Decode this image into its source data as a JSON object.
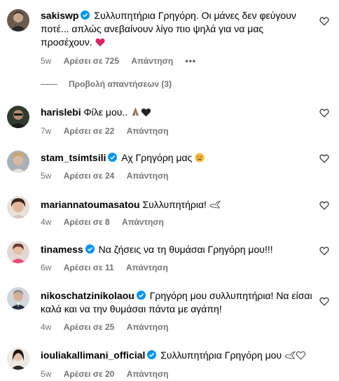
{
  "verified_color": "#0095f6",
  "comments": [
    {
      "username": "sakiswp",
      "verified": true,
      "text": "Συλλυπητήρια Γρηγόρη. Οι μάνες δεν φεύγουν ποτέ... απλώς ανεβαίνουν λίγο πιο ψηλά για να μας προσέχουν.",
      "emoji": "heart-red",
      "time": "5w",
      "likes": "Αρέσει σε 725",
      "reply": "Απάντηση",
      "more": "•••"
    },
    {
      "username": "harislebi",
      "verified": false,
      "text": "Φίλε μου..",
      "emoji": "pray-black-heart",
      "time": "7w",
      "likes": "Αρέσει σε 22",
      "reply": "Απάντηση"
    },
    {
      "username": "stam_tsimtsili",
      "verified": true,
      "text": "Αχ Γρηγόρη μας",
      "emoji": "sad-face",
      "time": "5w",
      "likes": "Αρέσει σε 24",
      "reply": "Απάντηση"
    },
    {
      "username": "mariannatoumasatou",
      "verified": false,
      "text": "Συλλυπητήρια!",
      "emoji": "dove",
      "time": "4w",
      "likes": "Αρέσει σε 8",
      "reply": "Απάντηση"
    },
    {
      "username": "tinamess",
      "verified": true,
      "text": "Να ζήσεις να τη θυμάσαι Γρηγόρη μου!!!",
      "time": "6w",
      "likes": "Αρέσει σε 11",
      "reply": "Απάντηση"
    },
    {
      "username": "nikoschatzinikolaou",
      "verified": true,
      "text": "Γρηγόρη μου συλλυπητήρια! Να είσαι καλά και να την θυμάσαι πάντα με αγάπη!",
      "time": "4w",
      "likes": "Αρέσει σε 25",
      "reply": "Απάντηση"
    },
    {
      "username": "iouliakallimani_official",
      "verified": true,
      "text": "Συλλυπητήρια Γρηγόρη μου",
      "emoji": "dove-white-heart",
      "time": "5w",
      "likes": "Αρέσει σε 20",
      "reply": "Απάντηση"
    }
  ],
  "view_replies": "Προβολή απαντήσεων (3)"
}
